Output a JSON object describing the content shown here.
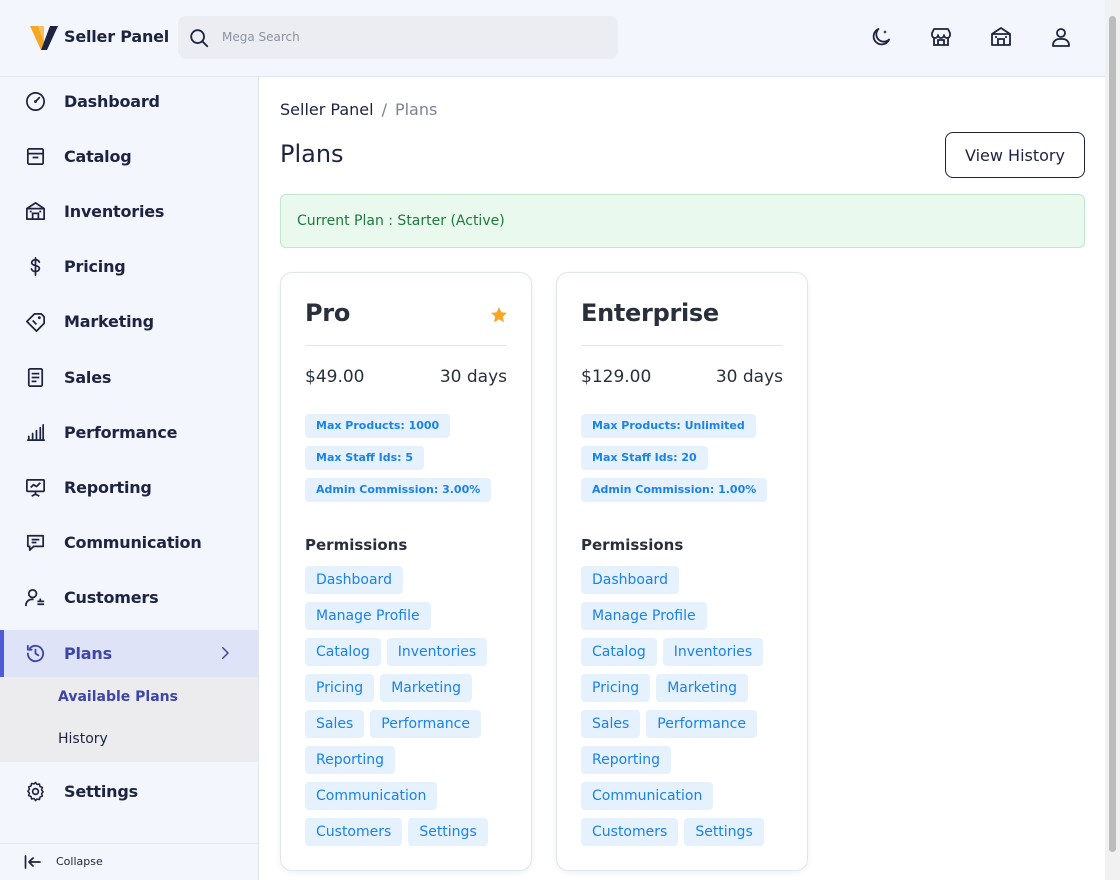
{
  "header": {
    "brand": "Seller Panel",
    "search_placeholder": "Mega Search",
    "icons": [
      "theme-toggle-icon",
      "store-icon",
      "shop-icon",
      "user-icon"
    ]
  },
  "sidebar": {
    "items": [
      {
        "label": "Dashboard",
        "icon": "dashboard-icon"
      },
      {
        "label": "Catalog",
        "icon": "catalog-icon"
      },
      {
        "label": "Inventories",
        "icon": "inventories-icon"
      },
      {
        "label": "Pricing",
        "icon": "dollar-icon"
      },
      {
        "label": "Marketing",
        "icon": "tag-icon"
      },
      {
        "label": "Sales",
        "icon": "document-icon"
      },
      {
        "label": "Performance",
        "icon": "bar-chart-icon"
      },
      {
        "label": "Reporting",
        "icon": "presentation-icon"
      },
      {
        "label": "Communication",
        "icon": "chat-icon"
      },
      {
        "label": "Customers",
        "icon": "customers-icon"
      },
      {
        "label": "Plans",
        "icon": "history-icon",
        "active": true
      },
      {
        "label": "Settings",
        "icon": "gear-icon"
      }
    ],
    "plans_sub": [
      {
        "label": "Available Plans",
        "active": true
      },
      {
        "label": "History"
      }
    ],
    "collapse_label": "Collapse"
  },
  "breadcrumb": [
    "Seller Panel",
    "/",
    "Plans"
  ],
  "page": {
    "title": "Plans",
    "view_history_label": "View History",
    "current_plan": "Current Plan : Starter (Active)"
  },
  "plans": [
    {
      "name": "Pro",
      "featured": true,
      "price": "$49.00",
      "duration": "30 days",
      "badges": [
        "Max Products: 1000",
        "Max Staff Ids: 5",
        "Admin Commission: 3.00%"
      ],
      "permissions_title": "Permissions",
      "permissions": [
        "Dashboard",
        "Manage Profile",
        "Catalog",
        "Inventories",
        "Pricing",
        "Marketing",
        "Sales",
        "Performance",
        "Reporting",
        "Communication",
        "Customers",
        "Settings"
      ]
    },
    {
      "name": "Enterprise",
      "featured": false,
      "price": "$129.00",
      "duration": "30 days",
      "badges": [
        "Max Products: Unlimited",
        "Max Staff Ids: 20",
        "Admin Commission: 1.00%"
      ],
      "permissions_title": "Permissions",
      "permissions": [
        "Dashboard",
        "Manage Profile",
        "Catalog",
        "Inventories",
        "Pricing",
        "Marketing",
        "Sales",
        "Performance",
        "Reporting",
        "Communication",
        "Customers",
        "Settings"
      ]
    }
  ],
  "colors": {
    "accent": "#4f5bd5",
    "chip_bg": "#e5f1fd",
    "chip_text": "#1b82e6",
    "success_bg": "#e9f9ee",
    "success_text": "#1f7a3c",
    "star": "#f5a623"
  }
}
